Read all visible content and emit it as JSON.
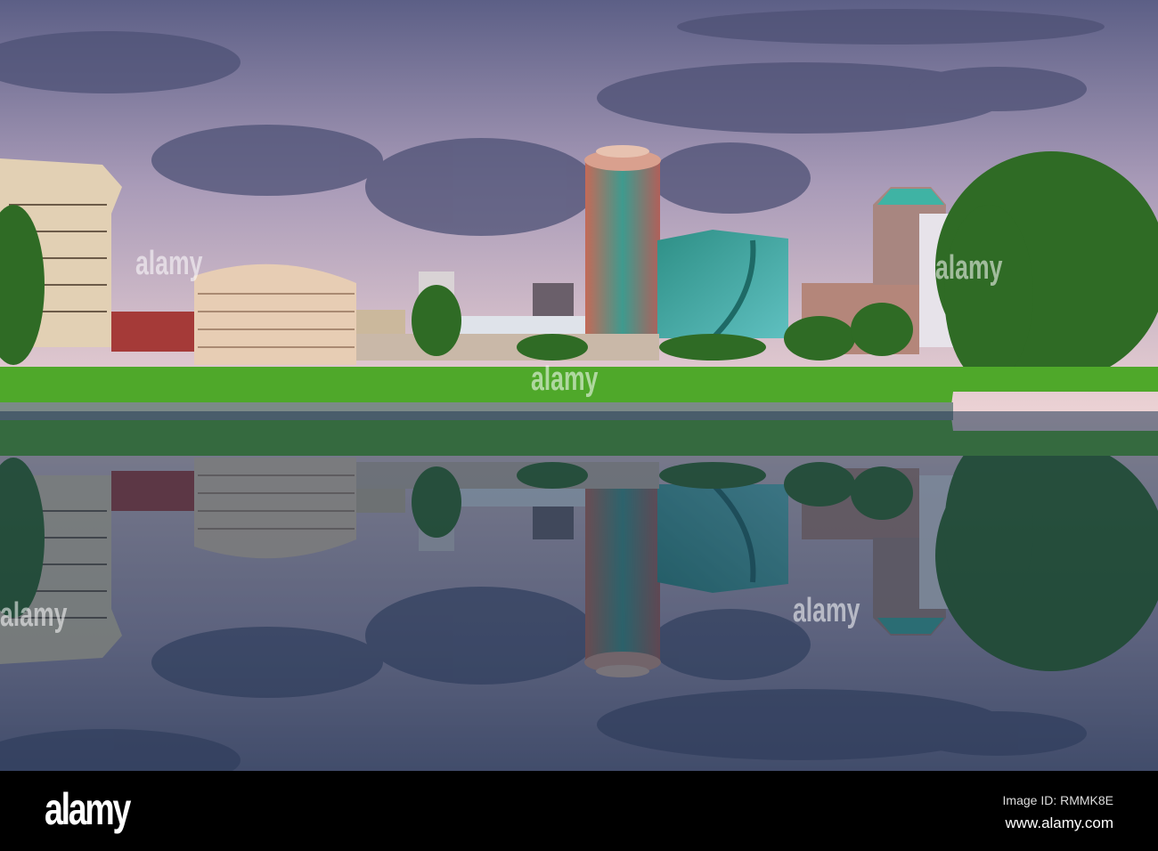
{
  "watermark": {
    "logo": "alamy",
    "image_id": "Image ID: RMMK8E",
    "url": "www.alamy.com"
  },
  "colors": {
    "sky_top": "#5c5f86",
    "sky_horizon": "#e8c9cf",
    "grass": "#4fa82a",
    "water": "#1f3a52"
  }
}
